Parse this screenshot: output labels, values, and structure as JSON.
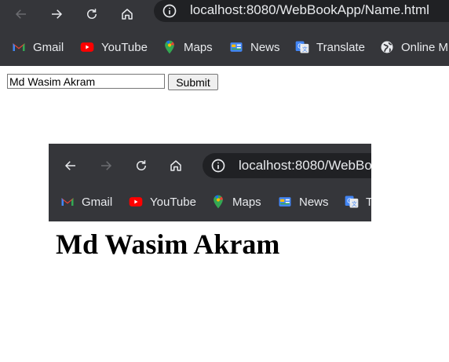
{
  "browser": {
    "url": "localhost:8080/WebBookApp/Name.html",
    "bookmarks": [
      {
        "label": "Gmail",
        "icon": "gmail-icon"
      },
      {
        "label": "YouTube",
        "icon": "youtube-icon"
      },
      {
        "label": "Maps",
        "icon": "maps-icon"
      },
      {
        "label": "News",
        "icon": "news-icon"
      },
      {
        "label": "Translate",
        "icon": "translate-icon"
      },
      {
        "label": "Online M",
        "icon": "globe-icon"
      }
    ]
  },
  "form": {
    "name_value": "Md Wasim Akram",
    "submit_label": "Submit"
  },
  "embedded_screenshot": {
    "url": "localhost:8080/WebBo",
    "bookmarks": [
      {
        "label": "Gmail",
        "icon": "gmail-icon"
      },
      {
        "label": "YouTube",
        "icon": "youtube-icon"
      },
      {
        "label": "Maps",
        "icon": "maps-icon"
      },
      {
        "label": "News",
        "icon": "news-icon"
      },
      {
        "label": "T",
        "icon": "translate-icon"
      }
    ],
    "heading": "Md Wasim Akram"
  },
  "colors": {
    "chrome_bg": "#35363a",
    "omnibox_bg": "#202124",
    "chrome_text": "#e8eaed"
  }
}
